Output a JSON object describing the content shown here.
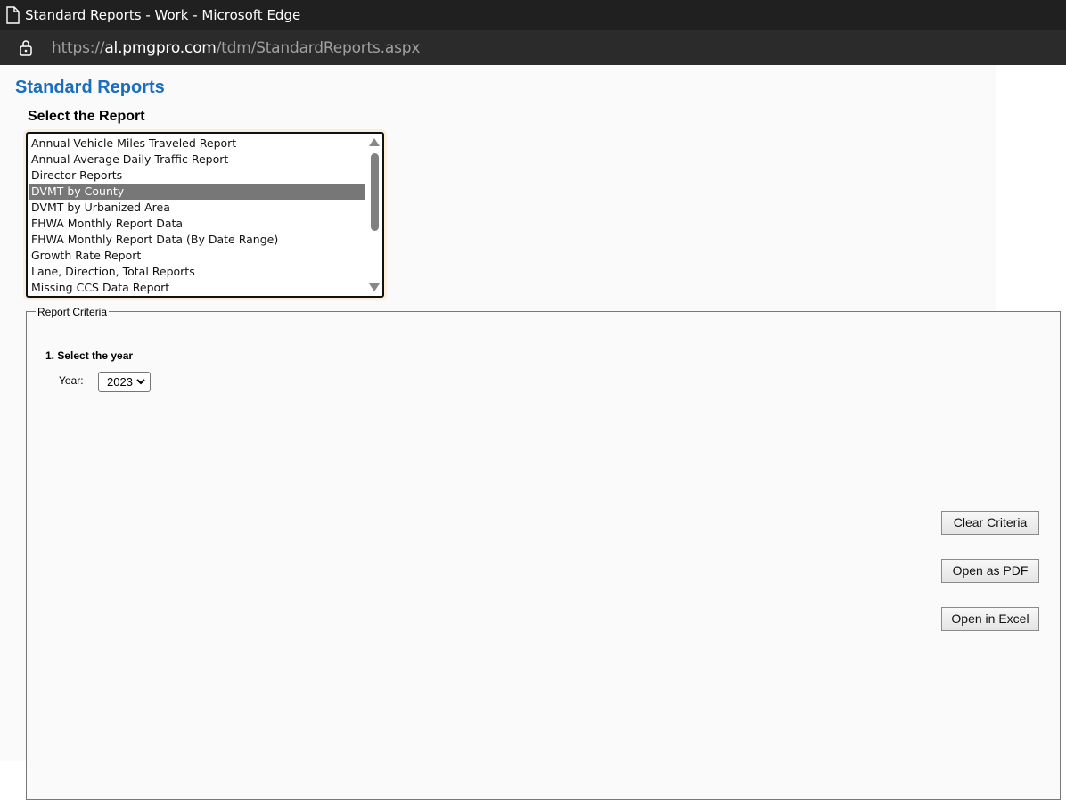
{
  "window": {
    "title": "Standard Reports - Work - Microsoft Edge"
  },
  "address": {
    "scheme": "https://",
    "host": "al.pmgpro.com",
    "path": "/tdm/StandardReports.aspx"
  },
  "page": {
    "title": "Standard Reports",
    "select_label": "Select the Report"
  },
  "report_list": {
    "items": [
      "Annual Vehicle Miles Traveled Report",
      "Annual Average Daily Traffic Report",
      "Director Reports",
      "DVMT by County",
      "DVMT by Urbanized Area",
      "FHWA Monthly Report Data",
      "FHWA Monthly Report Data (By Date Range)",
      "Growth Rate Report",
      "Lane, Direction, Total Reports",
      "Missing CCS Data Report"
    ],
    "selected": "DVMT by County"
  },
  "criteria": {
    "legend": "Report Criteria",
    "step1": "1. Select the year",
    "year_label": "Year:",
    "year_value": "2023"
  },
  "buttons": {
    "clear": "Clear Criteria",
    "pdf": "Open as PDF",
    "excel": "Open in Excel"
  }
}
